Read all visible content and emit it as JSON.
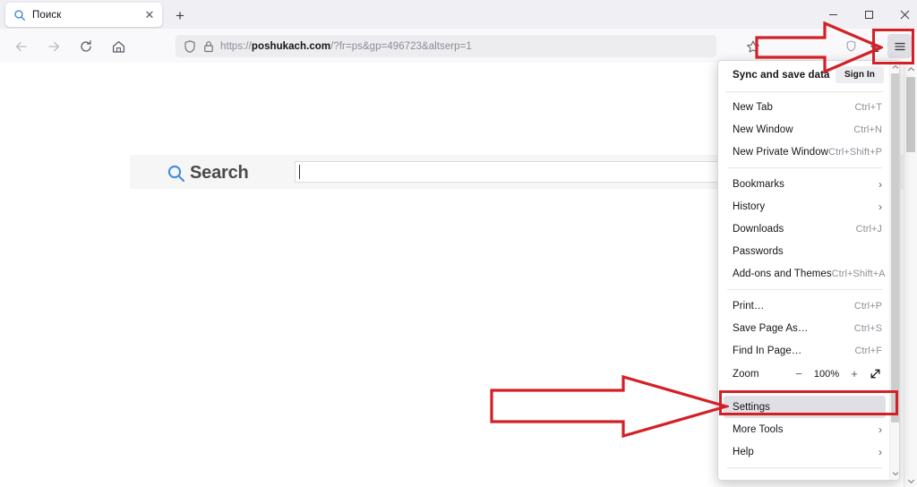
{
  "window": {
    "controls": [
      {
        "name": "minimize",
        "label": "—"
      },
      {
        "name": "maximize",
        "label": "❐"
      },
      {
        "name": "close",
        "label": "✕"
      }
    ]
  },
  "tabstrip": {
    "tab": {
      "title": "Поиск",
      "favicon": "search-icon",
      "close_label": "✕"
    },
    "new_tab_label": "+"
  },
  "toolbar": {
    "back_icon": "arrow-left-icon",
    "forward_icon": "arrow-right-icon",
    "reload_icon": "reload-icon",
    "home_icon": "home-icon",
    "url": {
      "scheme": "https://",
      "host": "poshukach.com",
      "path": "/?fr=ps&gp=496723&altserp=1",
      "full": "https://poshukach.com/?fr=ps&gp=496723&altserp=1",
      "shield_icon": "shield-icon",
      "lock_icon": "lock-icon"
    },
    "bookmark_icon": "star-icon",
    "protection_icon": "shield-pocket-icon",
    "downloads_icon": "download-arrow-icon",
    "menu_icon": "hamburger-menu-icon"
  },
  "page": {
    "search_logo_word": "Search",
    "search_logo_icon": "magnifier-icon",
    "search_input_value": "",
    "scrollbar": {
      "up_label": "⌃",
      "down_label": "⌄"
    }
  },
  "menu": {
    "sync": {
      "label": "Sync and save data",
      "button_label": "Sign In"
    },
    "groups": [
      {
        "items": [
          {
            "label": "New Tab",
            "shortcut": "Ctrl+T"
          },
          {
            "label": "New Window",
            "shortcut": "Ctrl+N"
          },
          {
            "label": "New Private Window",
            "shortcut": "Ctrl+Shift+P"
          }
        ]
      },
      {
        "items": [
          {
            "label": "Bookmarks",
            "submenu": "›"
          },
          {
            "label": "History",
            "submenu": "›"
          },
          {
            "label": "Downloads",
            "shortcut": "Ctrl+J"
          },
          {
            "label": "Passwords",
            "shortcut": ""
          },
          {
            "label": "Add-ons and Themes",
            "shortcut": "Ctrl+Shift+A"
          }
        ]
      },
      {
        "items": [
          {
            "label": "Print…",
            "shortcut": "Ctrl+P"
          },
          {
            "label": "Save Page As…",
            "shortcut": "Ctrl+S"
          },
          {
            "label": "Find In Page…",
            "shortcut": "Ctrl+F"
          }
        ]
      }
    ],
    "zoom": {
      "label": "Zoom",
      "minus_label": "−",
      "value": "100%",
      "plus_label": "+",
      "fullscreen_icon": "expand-diagonal-icon"
    },
    "bottom": [
      {
        "label": "Settings",
        "selected": true
      },
      {
        "label": "More Tools",
        "submenu": "›"
      },
      {
        "label": "Help",
        "submenu": "›"
      }
    ],
    "scrollbar": {
      "up_label": "⌃",
      "down_label": "⌄"
    }
  },
  "annotations": {
    "accent_color": "#d32027",
    "menu_button_box": "highlight around downloads and menu buttons",
    "settings_box": "highlight around Settings menu item",
    "arrow_top": "arrow pointing to hamburger menu button",
    "arrow_bottom": "arrow pointing to Settings menu item"
  },
  "colors": {
    "tabstrip_bg": "#f0f0f4",
    "toolbar_bg": "#f9f9fb",
    "urlbar_bg": "#ededf0",
    "menu_bg": "#ffffff",
    "selected_row_bg": "#e0e0e4",
    "accent_red": "#d32027",
    "search_band_bg": "#f6f6f7",
    "logo_blue": "#4a90d9"
  }
}
